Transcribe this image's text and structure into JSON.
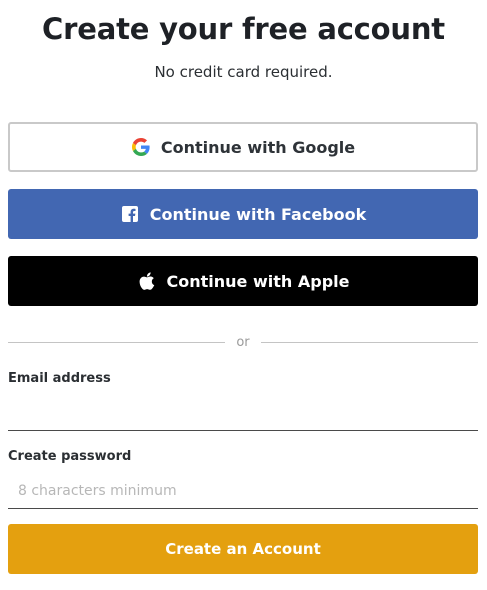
{
  "header": {
    "title": "Create your free account",
    "subtitle": "No credit card required."
  },
  "social": {
    "google_label": "Continue with Google",
    "facebook_label": "Continue with Facebook",
    "apple_label": "Continue with Apple",
    "google_icon": "google-icon",
    "facebook_icon": "facebook-icon",
    "apple_icon": "apple-icon"
  },
  "divider": {
    "text": "or"
  },
  "form": {
    "email_label": "Email address",
    "email_value": "",
    "email_placeholder": "",
    "password_label": "Create password",
    "password_value": "",
    "password_placeholder": "8 characters minimum",
    "submit_label": "Create an Account"
  },
  "colors": {
    "facebook": "#4267b2",
    "apple": "#000000",
    "primary": "#e4a00f"
  }
}
